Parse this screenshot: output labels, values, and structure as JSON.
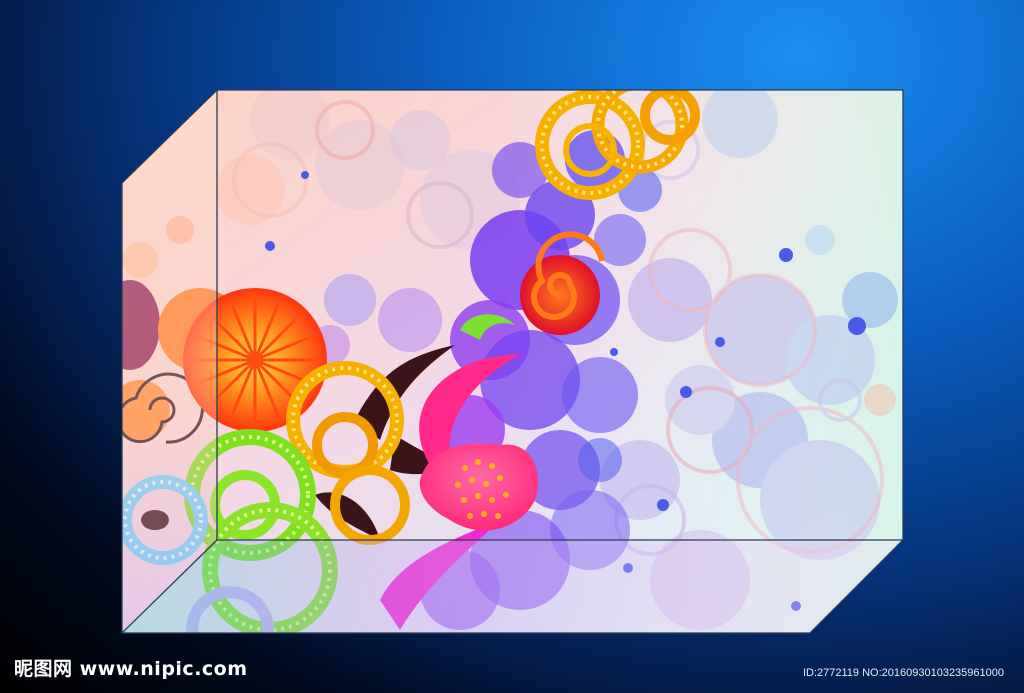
{
  "watermark": {
    "site": "昵图网 www.nipic.com",
    "id": "ID:2772119 NO:20160930103235961000"
  },
  "colors": {
    "bg_dark": "#000000",
    "bg_blue": "#1a8ff0",
    "panel_peach": "#fbd9c4",
    "panel_mint": "#d8f6e6",
    "orange_flower": "#ff6a1a",
    "yellow_ring": "#f5b800",
    "green_ring": "#8fe82a",
    "purple_bubble": "#7b3cff",
    "pink_leaf": "#ff2a8a",
    "cyan_ring": "#7fe0ff"
  }
}
